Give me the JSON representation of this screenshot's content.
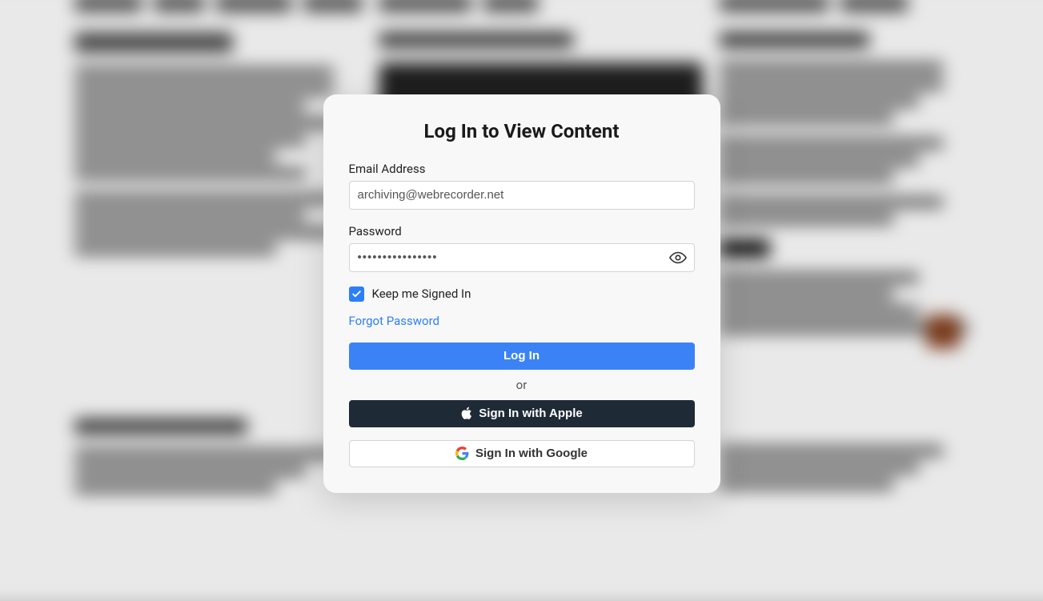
{
  "modal": {
    "title": "Log In to View Content",
    "email_label": "Email Address",
    "email_value": "archiving@webrecorder.net",
    "password_label": "Password",
    "password_value": "••••••••••••••••",
    "keep_signed_in_label": "Keep me Signed In",
    "keep_signed_in_checked": true,
    "forgot_label": "Forgot Password",
    "login_button": "Log In",
    "or_label": "or",
    "apple_button": "Sign In with Apple",
    "google_button": "Sign In with Google"
  }
}
